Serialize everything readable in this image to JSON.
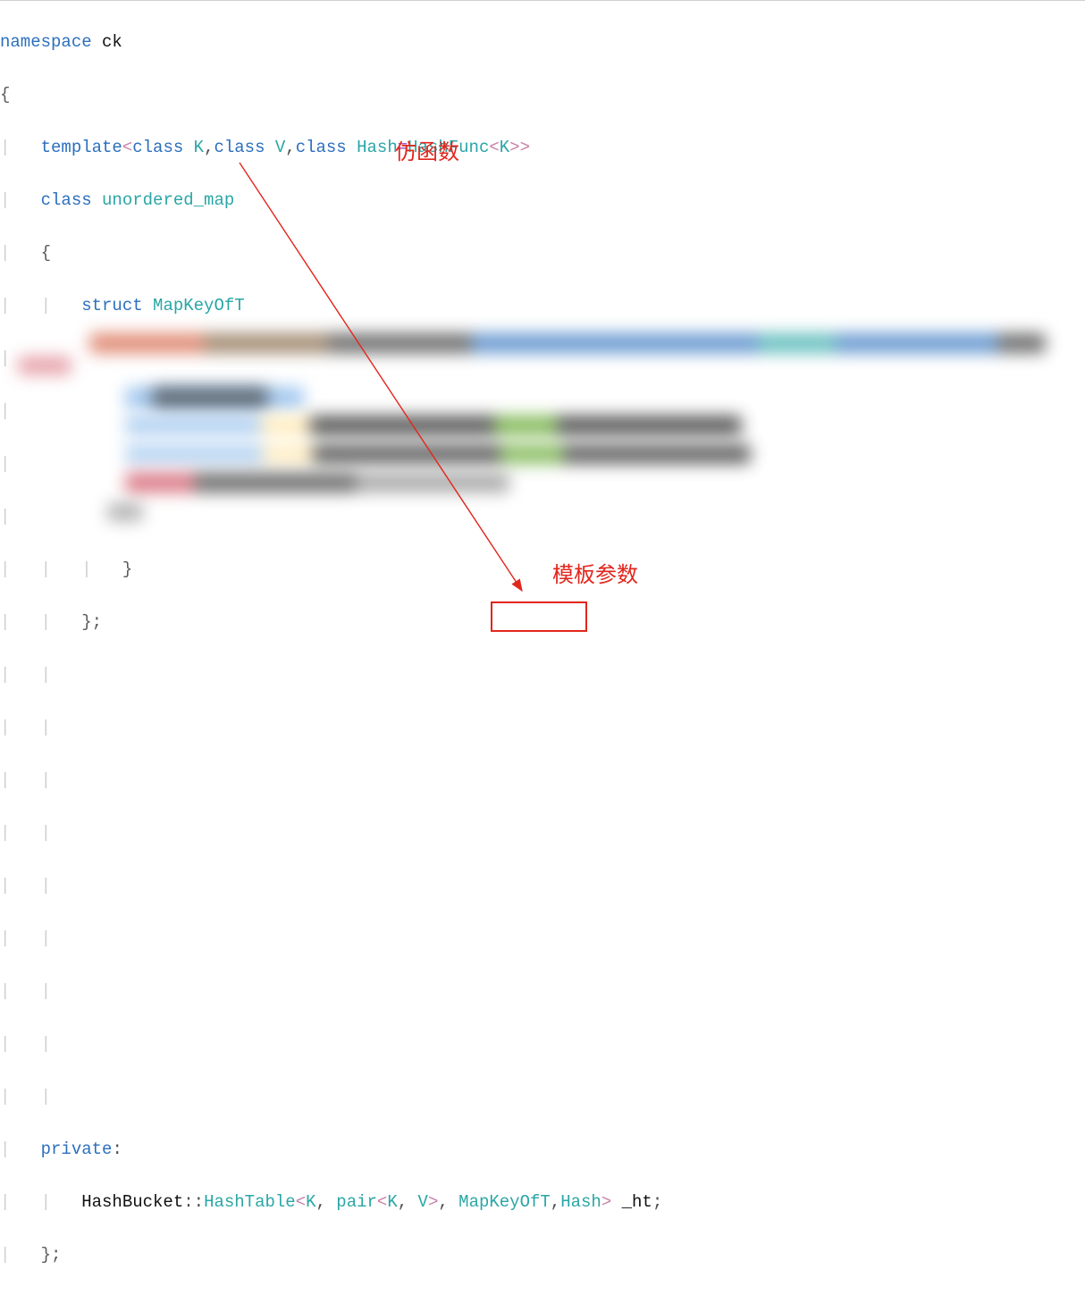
{
  "annotations": {
    "functor": "仿函数",
    "template_param": "模板参数"
  },
  "code": {
    "l1": {
      "kw": "namespace",
      "name": "ck"
    },
    "l2": {
      "brace": "{"
    },
    "l3": {
      "kw": "template",
      "lt": "<",
      "class1": "class",
      "K": "K",
      "comma1": ",",
      "class2": "class",
      "V": "V",
      "comma2": ",",
      "class3": "class",
      "Hash": "Hash",
      "eq": "=",
      "HashFunc": "HashFunc",
      "lt2": "<",
      "K2": "K",
      "gt": ">>"
    },
    "l4": {
      "kw": "class",
      "name": "unordered_map"
    },
    "l5": {
      "brace": "{"
    },
    "l6": {
      "kw": "struct",
      "name": "MapKeyOfT"
    },
    "l7": {
      "brace": "{"
    },
    "l8": {
      "const1": "const",
      "K": "K",
      "amp": "&",
      "op": "operator",
      "parens": "()(",
      "const2": "const",
      "pair": "pair",
      "lt": "<",
      "sp": " ",
      "K2": "K",
      "comma": ",",
      "sp2": " ",
      "V": "V",
      "gt": ">",
      "amp2": "&",
      "kv": " kv",
      "close": ")",
      "const3": " const"
    },
    "l9": {
      "brace": "{"
    },
    "l10": {
      "ret": "return",
      "kv": " kv",
      "dot": ".",
      "first": "first",
      "semi": ";"
    },
    "l11": {
      "brace": "}"
    },
    "l12": {
      "close": "};"
    },
    "l22": {
      "kw": "private",
      "colon": ":"
    },
    "l23": {
      "ns": "HashBucket",
      "scope": "::",
      "ht": "HashTable",
      "lt": "<",
      "K": "K",
      "c1": ",",
      "pair": " pair",
      "lt2": "<",
      "K2": "K",
      "c2": ",",
      "V": " V",
      "gt": ">",
      "c3": ",",
      "MapKeyOfT": " MapKeyOfT",
      "c4": ",",
      "Hash": "Hash",
      "gt2": ">",
      "var": " _ht",
      "semi": ";"
    },
    "l24": {
      "close": "};"
    }
  }
}
